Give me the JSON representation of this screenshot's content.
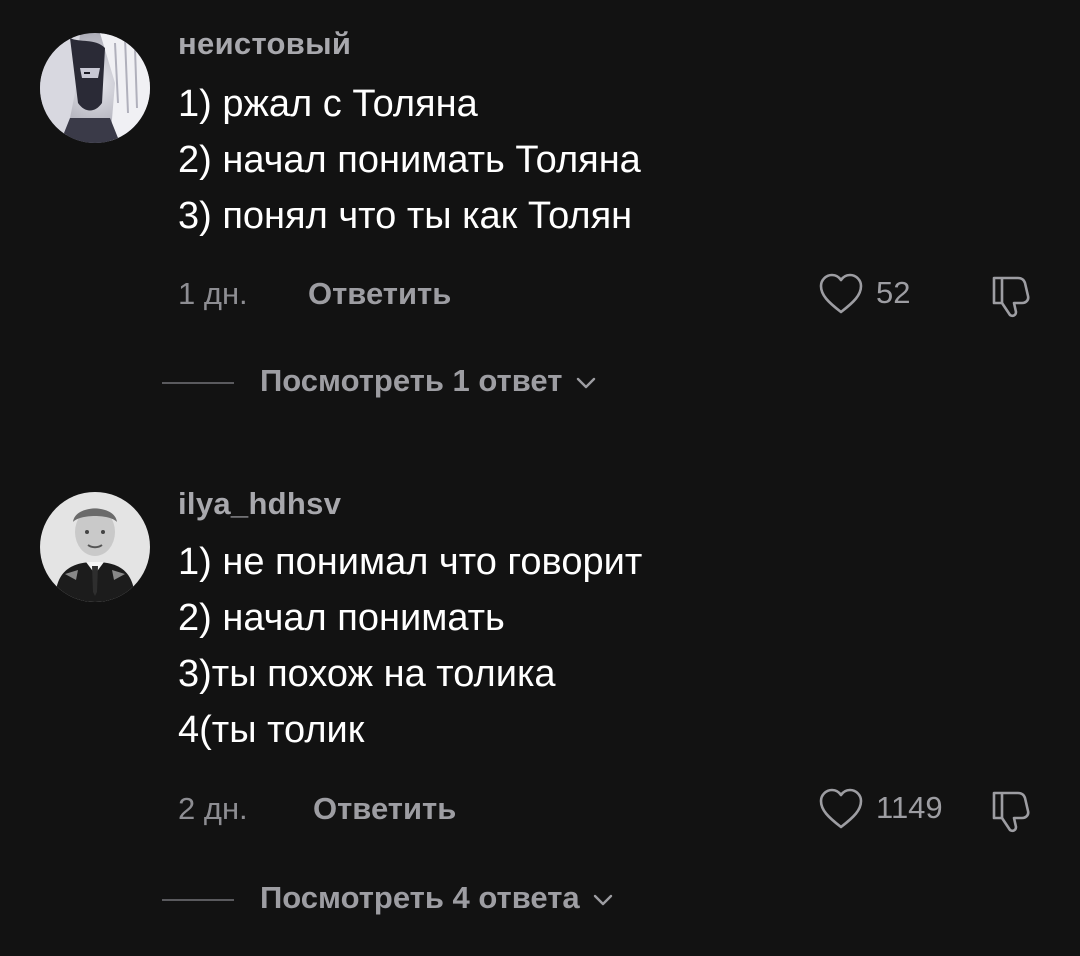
{
  "comments": [
    {
      "username": "неистовый",
      "lines": [
        "1) ржал с Толяна",
        "2) начал понимать Толяна",
        "3) понял что ты как Толян"
      ],
      "time": "1 дн.",
      "reply_label": "Ответить",
      "like_count": "52",
      "view_replies_label": "Посмотреть 1 ответ"
    },
    {
      "username": "ilya_hdhsv",
      "lines": [
        "1) не понимал что говорит",
        "2) начал понимать",
        "3)ты похож на толика",
        "4(ты толик"
      ],
      "time": "2 дн.",
      "reply_label": "Ответить",
      "like_count": "1149",
      "view_replies_label": "Посмотреть 4 ответа"
    }
  ],
  "icons": {
    "like": "heart-outline-icon",
    "dislike": "thumbs-down-icon",
    "expand": "chevron-down-icon"
  },
  "colors": {
    "background": "#121212",
    "text_primary": "#ffffff",
    "text_secondary": "#9d9da2"
  }
}
